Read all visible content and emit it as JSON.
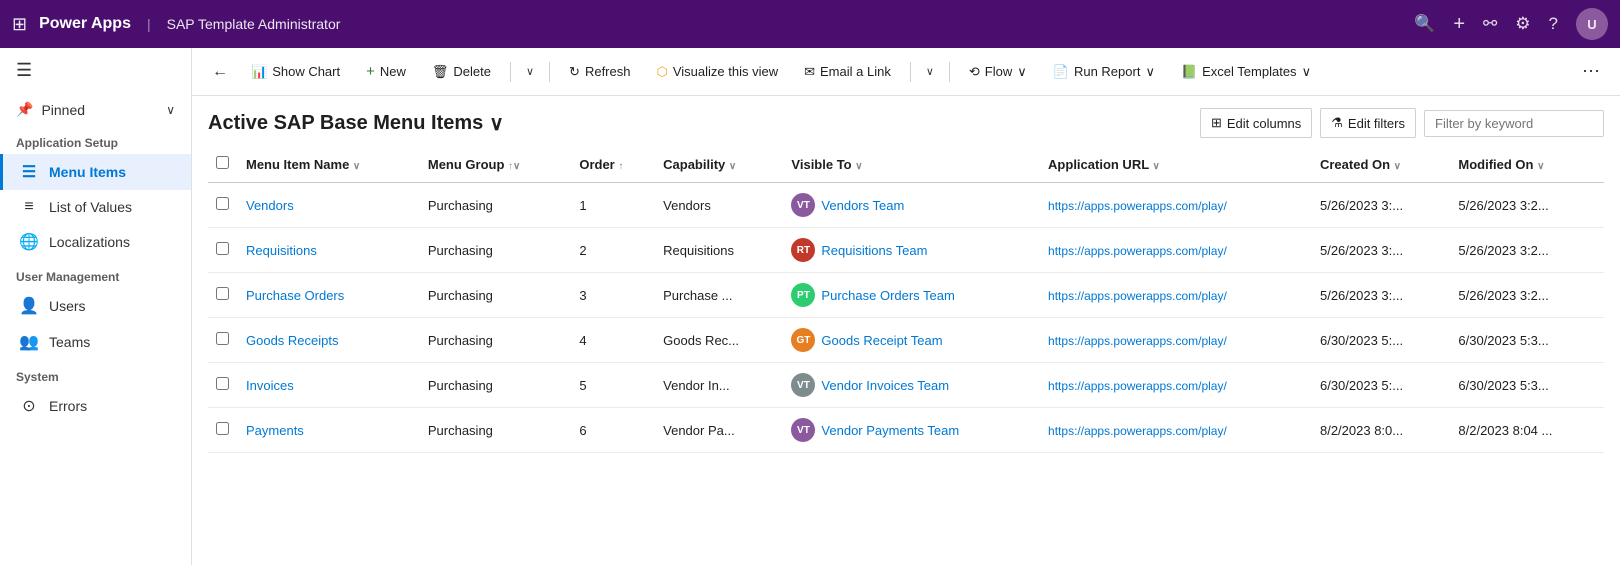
{
  "topNav": {
    "gridIcon": "⊞",
    "appName": "Power Apps",
    "separator": "|",
    "pageTitle": "SAP Template Administrator",
    "searchIcon": "🔍",
    "addIcon": "+",
    "filterIcon": "⚗",
    "settingsIcon": "⚙",
    "helpIcon": "?",
    "avatarInitial": "U"
  },
  "sidebar": {
    "hamburgerIcon": "☰",
    "pinnedLabel": "Pinned",
    "pinnedChevron": "∨",
    "sections": [
      {
        "name": "Application Setup",
        "items": [
          {
            "id": "menu-items",
            "icon": "☰",
            "label": "Menu Items",
            "active": true
          },
          {
            "id": "list-of-values",
            "icon": "≡",
            "label": "List of Values",
            "active": false
          },
          {
            "id": "localizations",
            "icon": "🌐",
            "label": "Localizations",
            "active": false
          }
        ]
      },
      {
        "name": "User Management",
        "items": [
          {
            "id": "users",
            "icon": "👤",
            "label": "Users",
            "active": false
          },
          {
            "id": "teams",
            "icon": "👥",
            "label": "Teams",
            "active": false
          }
        ]
      },
      {
        "name": "System",
        "items": [
          {
            "id": "errors",
            "icon": "⊙",
            "label": "Errors",
            "active": false
          }
        ]
      }
    ]
  },
  "toolbar": {
    "backIcon": "←",
    "showChartIcon": "📊",
    "showChartLabel": "Show Chart",
    "newIcon": "+",
    "newLabel": "New",
    "deleteIcon": "🗑",
    "deleteLabel": "Delete",
    "deleteChevron": "∨",
    "refreshIcon": "↻",
    "refreshLabel": "Refresh",
    "visualizeIcon": "⬡",
    "visualizeLabel": "Visualize this view",
    "emailIcon": "✉",
    "emailLabel": "Email a Link",
    "emailChevron": "∨",
    "flowIcon": "⟲",
    "flowLabel": "Flow",
    "flowChevron": "∨",
    "runReportIcon": "📄",
    "runReportLabel": "Run Report",
    "runReportChevron": "∨",
    "excelIcon": "📗",
    "excelLabel": "Excel Templates",
    "excelChevron": "∨",
    "moreIcon": "⋯"
  },
  "pageHeader": {
    "title": "Active SAP Base Menu Items",
    "chevron": "∨",
    "editColumnsIcon": "⊞",
    "editColumnsLabel": "Edit columns",
    "editFiltersIcon": "⚗",
    "editFiltersLabel": "Edit filters",
    "filterPlaceholder": "Filter by keyword"
  },
  "table": {
    "columns": [
      {
        "id": "menu-item-name",
        "label": "Menu Item Name",
        "sortIcon": "∨"
      },
      {
        "id": "menu-group",
        "label": "Menu Group",
        "sortIcon": "↑∨"
      },
      {
        "id": "order",
        "label": "Order",
        "sortIcon": "↑"
      },
      {
        "id": "capability",
        "label": "Capability",
        "sortIcon": "∨"
      },
      {
        "id": "visible-to",
        "label": "Visible To",
        "sortIcon": "∨"
      },
      {
        "id": "application-url",
        "label": "Application URL",
        "sortIcon": "∨"
      },
      {
        "id": "created-on",
        "label": "Created On",
        "sortIcon": "∨"
      },
      {
        "id": "modified-on",
        "label": "Modified On",
        "sortIcon": "∨"
      }
    ],
    "rows": [
      {
        "id": "row-1",
        "menuItemName": "Vendors",
        "menuGroup": "Purchasing",
        "order": "1",
        "capability": "Vendors",
        "teamAvatarBg": "#8b5a9e",
        "teamAvatarText": "VT",
        "visibleTo": "Vendors Team",
        "applicationUrl": "https://apps.powerapps.com/play/",
        "createdOn": "5/26/2023 3:...",
        "modifiedOn": "5/26/2023 3:2..."
      },
      {
        "id": "row-2",
        "menuItemName": "Requisitions",
        "menuGroup": "Purchasing",
        "order": "2",
        "capability": "Requisitions",
        "teamAvatarBg": "#c0392b",
        "teamAvatarText": "RT",
        "visibleTo": "Requisitions Team",
        "applicationUrl": "https://apps.powerapps.com/play/",
        "createdOn": "5/26/2023 3:...",
        "modifiedOn": "5/26/2023 3:2..."
      },
      {
        "id": "row-3",
        "menuItemName": "Purchase Orders",
        "menuGroup": "Purchasing",
        "order": "3",
        "capability": "Purchase ...",
        "teamAvatarBg": "#2ecc71",
        "teamAvatarText": "PT",
        "visibleTo": "Purchase Orders Team",
        "applicationUrl": "https://apps.powerapps.com/play/",
        "createdOn": "5/26/2023 3:...",
        "modifiedOn": "5/26/2023 3:2..."
      },
      {
        "id": "row-4",
        "menuItemName": "Goods Receipts",
        "menuGroup": "Purchasing",
        "order": "4",
        "capability": "Goods Rec...",
        "teamAvatarBg": "#e67e22",
        "teamAvatarText": "GT",
        "visibleTo": "Goods Receipt Team",
        "applicationUrl": "https://apps.powerapps.com/play/",
        "createdOn": "6/30/2023 5:...",
        "modifiedOn": "6/30/2023 5:3..."
      },
      {
        "id": "row-5",
        "menuItemName": "Invoices",
        "menuGroup": "Purchasing",
        "order": "5",
        "capability": "Vendor In...",
        "teamAvatarBg": "#7f8c8d",
        "teamAvatarText": "VT",
        "visibleTo": "Vendor Invoices Team",
        "applicationUrl": "https://apps.powerapps.com/play/",
        "createdOn": "6/30/2023 5:...",
        "modifiedOn": "6/30/2023 5:3..."
      },
      {
        "id": "row-6",
        "menuItemName": "Payments",
        "menuGroup": "Purchasing",
        "order": "6",
        "capability": "Vendor Pa...",
        "teamAvatarBg": "#8b5a9e",
        "teamAvatarText": "VT",
        "visibleTo": "Vendor Payments Team",
        "applicationUrl": "https://apps.powerapps.com/play/",
        "createdOn": "8/2/2023 8:0...",
        "modifiedOn": "8/2/2023 8:04 ..."
      }
    ]
  }
}
